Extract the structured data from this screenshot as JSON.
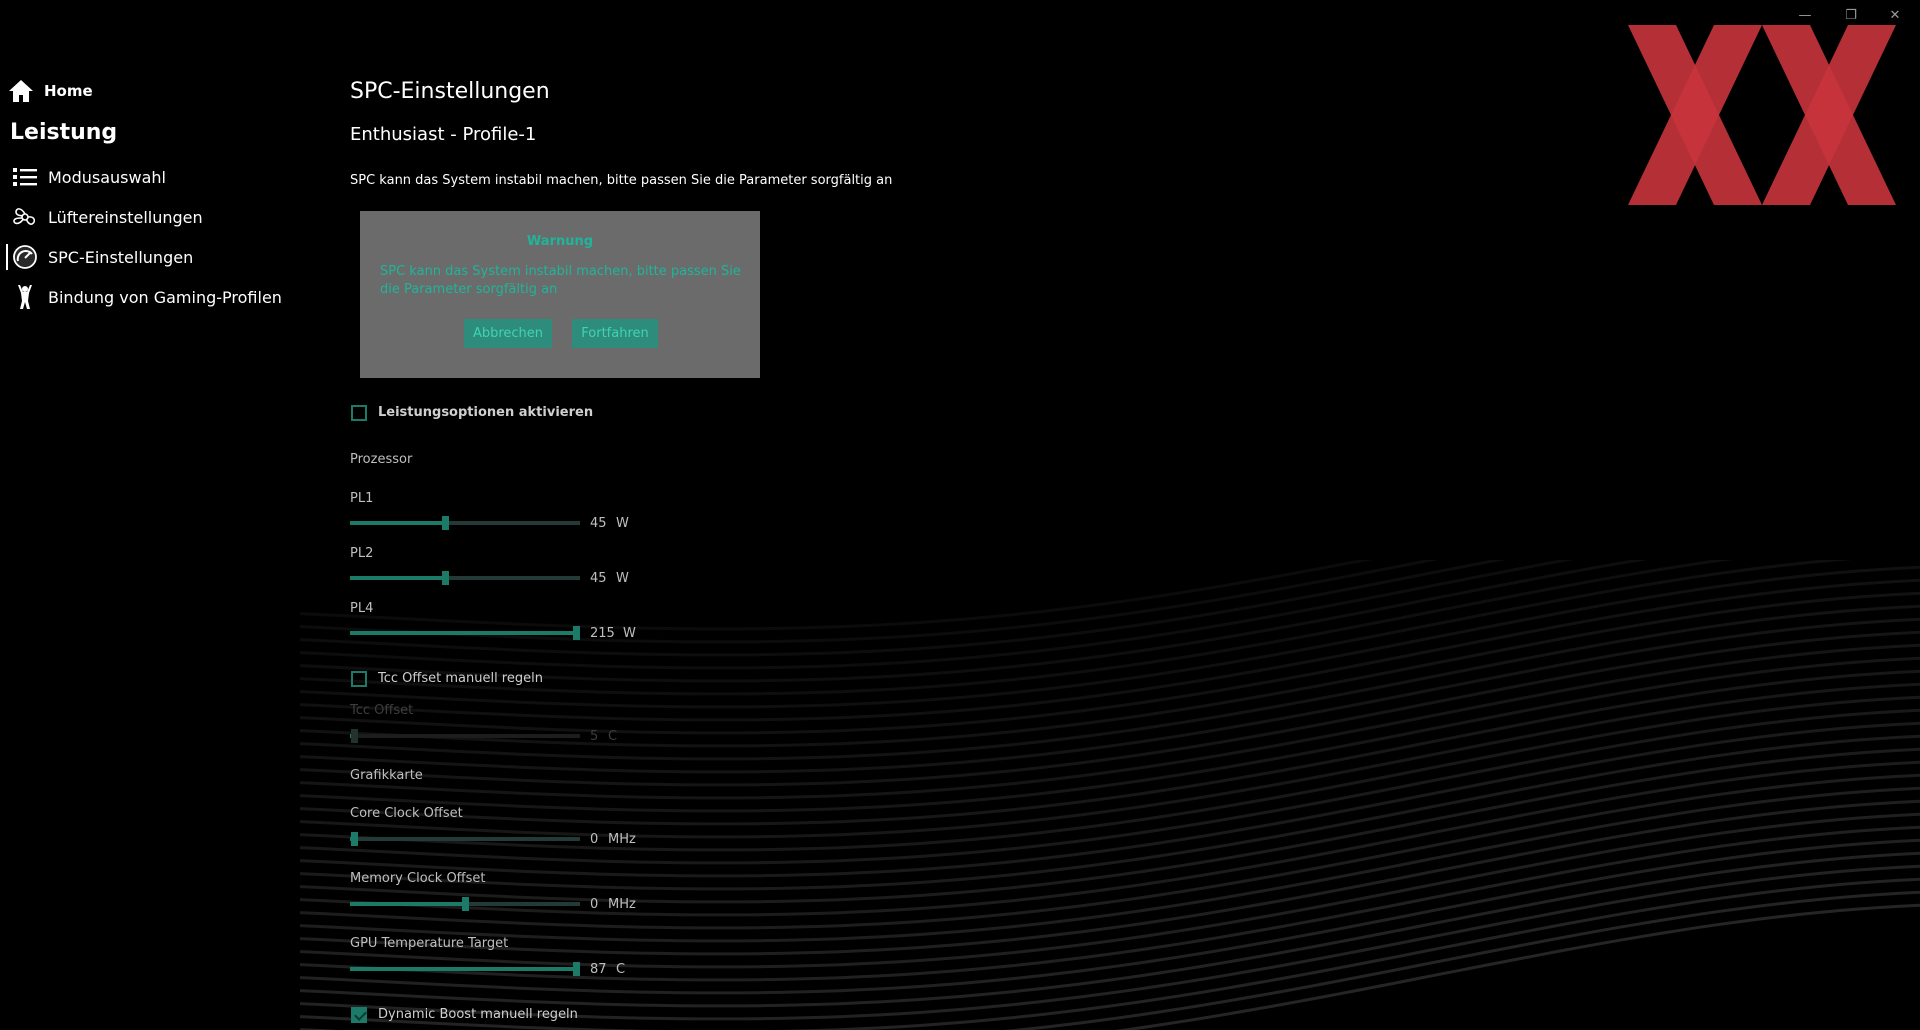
{
  "window": {
    "minimize_label": "—",
    "maximize_label": "❐",
    "close_label": "✕"
  },
  "brand": {
    "color": "#c8343c"
  },
  "sidebar": {
    "home": "Home",
    "section": "Leistung",
    "items": [
      {
        "label": "Modusauswahl",
        "icon": "list-icon"
      },
      {
        "label": "Lüftereinstellungen",
        "icon": "fan-icon"
      },
      {
        "label": "SPC-Einstellungen",
        "icon": "gauge-icon",
        "active": true
      },
      {
        "label": "Bindung von Gaming-Profilen",
        "icon": "gamer-icon"
      }
    ]
  },
  "main": {
    "title": "SPC-Einstellungen",
    "profile": "Enthusiast - Profile-1",
    "note": "SPC kann das System instabil machen, bitte passen Sie die Parameter sorgfältig an"
  },
  "dialog": {
    "title": "Warnung",
    "message": "SPC kann das System instabil machen, bitte passen Sie die Parameter sorgfältig an",
    "cancel": "Abbrechen",
    "confirm": "Fortfahren"
  },
  "options": {
    "enable_label": "Leistungsoptionen aktivieren",
    "enable_checked": false,
    "processor_section": "Prozessor",
    "gpu_section": "Grafikkarte",
    "tcc_manual_label": "Tcc Offset manuell regeln",
    "tcc_manual_checked": false,
    "dynamic_boost_label": "Dynamic Boost manuell regeln",
    "dynamic_boost_checked": true
  },
  "sliders": {
    "pl1": {
      "label": "PL1",
      "value": "45",
      "unit": "W",
      "fraction": 0.41
    },
    "pl2": {
      "label": "PL2",
      "value": "45",
      "unit": "W",
      "fraction": 0.41
    },
    "pl4": {
      "label": "PL4",
      "value": "215",
      "unit": "W",
      "fraction": 1.0
    },
    "tcc": {
      "label": "Tcc Offset",
      "value": "5",
      "unit": "C",
      "fraction": 0.0,
      "disabled": true
    },
    "core": {
      "label": "Core Clock Offset",
      "value": "0",
      "unit": "MHz",
      "fraction": 0.0
    },
    "memory": {
      "label": "Memory Clock Offset",
      "value": "0",
      "unit": "MHz",
      "fraction": 0.5
    },
    "gputemp": {
      "label": "GPU Temperature Target",
      "value": "87",
      "unit": "C",
      "fraction": 1.0
    }
  }
}
